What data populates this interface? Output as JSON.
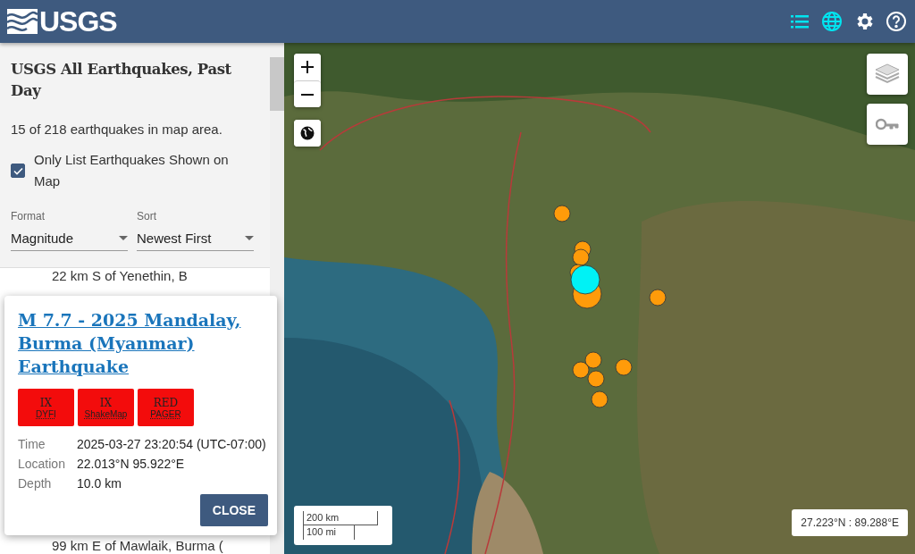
{
  "header": {
    "logo": "USGS",
    "icons": [
      {
        "kind": "list",
        "selected": true
      },
      {
        "kind": "map",
        "selected": true
      },
      {
        "kind": "settings",
        "selected": false
      },
      {
        "kind": "help",
        "selected": false
      }
    ]
  },
  "sidebar": {
    "title": "USGS All Earthquakes, Past Day",
    "count": "15 of 218 earthquakes in map area.",
    "only_list_shown": {
      "label": "Only List Earthquakes Shown on Map",
      "checked": true
    },
    "selects": [
      {
        "label": "Format",
        "value": "Magnitude"
      },
      {
        "label": "Sort",
        "value": "Newest First"
      }
    ],
    "list_items": [
      "22 km S of Yenethin, B",
      "99 km E of Mawlaik, Burma ("
    ]
  },
  "popup": {
    "title": "M 7.7 - 2025 Mandalay, Burma (Myanmar) Earthquake",
    "badges": [
      {
        "value": "IX",
        "label": "DYFI"
      },
      {
        "value": "IX",
        "label": "ShakeMap"
      },
      {
        "value": "RED",
        "label": "PAGER"
      }
    ],
    "details": [
      {
        "label": "Time",
        "value": "2025-03-27 23:20:54 (UTC-07:00)"
      },
      {
        "label": "Location",
        "value": "22.013°N 95.922°E"
      },
      {
        "label": "Depth",
        "value": "10.0 km"
      }
    ],
    "close": "CLOSE"
  },
  "map": {
    "scale": [
      "200 km",
      "100 mi"
    ],
    "coordinates": "27.223°N : 89.288°E"
  }
}
